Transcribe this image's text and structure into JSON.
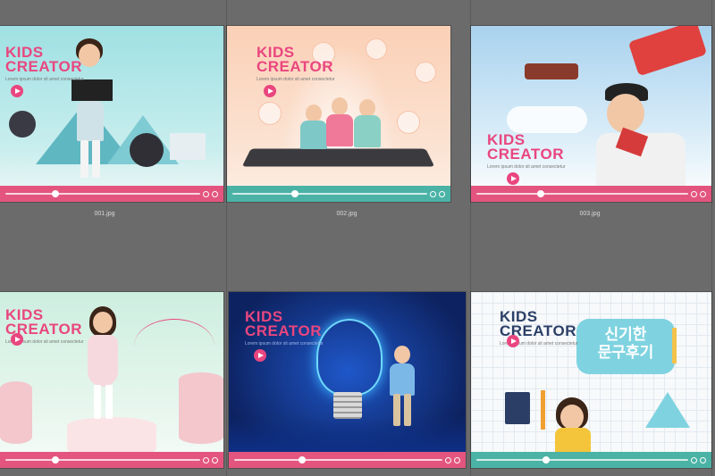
{
  "thumbnails": [
    {
      "file": "001.jpg",
      "title_line1": "KIDS",
      "title_line2": "CREATOR",
      "subtitle": "Lorem ipsum dolor sit amet consectetur"
    },
    {
      "file": "002.jpg",
      "title_line1": "KIDS",
      "title_line2": "CREATOR",
      "subtitle": "Lorem ipsum dolor sit amet consectetur"
    },
    {
      "file": "003.jpg",
      "title_line1": "KIDS",
      "title_line2": "CREATOR",
      "subtitle": "Lorem ipsum dolor sit amet consectetur"
    },
    {
      "file": "",
      "title_line1": "KIDS",
      "title_line2": "CREATOR",
      "subtitle": "Lorem ipsum dolor sit amet consectetur"
    },
    {
      "file": "",
      "title_line1": "KIDS",
      "title_line2": "CREATOR",
      "subtitle": "Lorem ipsum dolor sit amet consectetur"
    },
    {
      "file": "",
      "title_line1": "KIDS",
      "title_line2": "CREATOR",
      "subtitle": "Lorem ipsum dolor sit amet consectetur",
      "korean_line1": "신기한",
      "korean_line2": "문구후기"
    }
  ],
  "colors": {
    "background": "#6b6b6b",
    "brand_pink": "#e9467f",
    "bar_pink": "#e3557f",
    "bar_teal": "#4bb3a6",
    "bar_navy": "#2d3a8c"
  },
  "progress": [
    0.25,
    0.3,
    0.3,
    0.25,
    0.3,
    0.3
  ]
}
